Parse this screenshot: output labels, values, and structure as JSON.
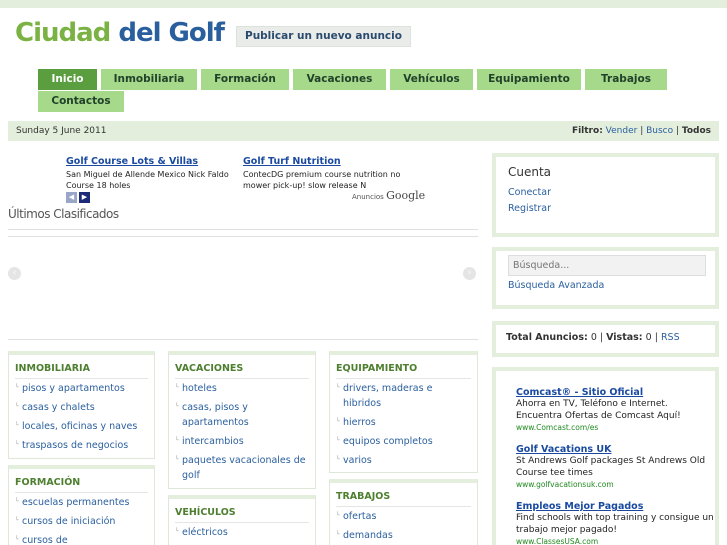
{
  "logo": {
    "part1": "Ciudad",
    "part2": "del Golf"
  },
  "header": {
    "publish_label": "Publicar un nuevo anuncio"
  },
  "nav": {
    "tabs": [
      {
        "label": "Inicio"
      },
      {
        "label": "Inmobiliaria"
      },
      {
        "label": "Formación"
      },
      {
        "label": "Vacaciones"
      },
      {
        "label": "Vehículos"
      },
      {
        "label": "Equipamiento"
      },
      {
        "label": "Trabajos"
      },
      {
        "label": "Contactos"
      }
    ]
  },
  "datebar": {
    "date": "Sunday 5 June 2011",
    "filter_label": "Filtro",
    "filters": [
      "Vender",
      "Busco",
      "Todos"
    ]
  },
  "top_ads": [
    {
      "title": "Golf Course Lots & Villas",
      "text": "San Miguel de Allende Mexico Nick Faldo Course 18 holes"
    },
    {
      "title": "Golf Turf Nutrition",
      "text": "ContecDG premium course nutrition no mower pick-up! slow release N"
    }
  ],
  "ads_brand": {
    "prefix": "Anuncios",
    "name": "Google"
  },
  "section_title": "Últimos Clasificados",
  "categories": {
    "inmobiliaria": {
      "title": "INMOBILIARIA",
      "items": [
        "pisos y apartamentos",
        "casas y chalets",
        "locales, oficinas y naves",
        "traspasos de negocios"
      ]
    },
    "formacion": {
      "title": "FORMACIÓN",
      "items": [
        "escuelas permanentes",
        "cursos de iniciación",
        "cursos de"
      ]
    },
    "vacaciones": {
      "title": "VACACIONES",
      "items": [
        "hoteles",
        "casas, pisos y apartamentos",
        "intercambios",
        "paquetes vacacionales de golf"
      ]
    },
    "vehiculos": {
      "title": "VEHÍCULOS",
      "items": [
        "eléctricos"
      ]
    },
    "equipamiento": {
      "title": "EQUIPAMIENTO",
      "items": [
        "drivers, maderas e hibridos",
        "hierros",
        "equipos completos",
        "varios"
      ]
    },
    "trabajos": {
      "title": "TRABAJOS",
      "items": [
        "ofertas",
        "demandas"
      ]
    }
  },
  "sidebar": {
    "account": {
      "title": "Cuenta",
      "links": [
        "Conectar",
        "Registrar"
      ]
    },
    "search": {
      "placeholder": "Búsqueda...",
      "advanced": "Búsqueda Avanzada"
    },
    "stats": {
      "ads_label": "Total Anuncios:",
      "ads": "0",
      "views_label": "Vistas:",
      "views": "0",
      "rss": "RSS"
    },
    "ads": [
      {
        "title": "Comcast® - Sitio Oficial",
        "text": "Ahorra en TV, Teléfono e Internet. Encuentra Ofertas de Comcast Aquí!",
        "url": "www.Comcast.com/es"
      },
      {
        "title": "Golf Vacations UK",
        "text": "St Andrews Golf packages St Andrews Old Course tee times",
        "url": "www.golfvacationsuk.com"
      },
      {
        "title": "Empleos Mejor Pagados",
        "text": "Find schools with top training y consigue un trabajo mejor pagado!",
        "url": "www.ClassesUSA.com"
      }
    ]
  }
}
